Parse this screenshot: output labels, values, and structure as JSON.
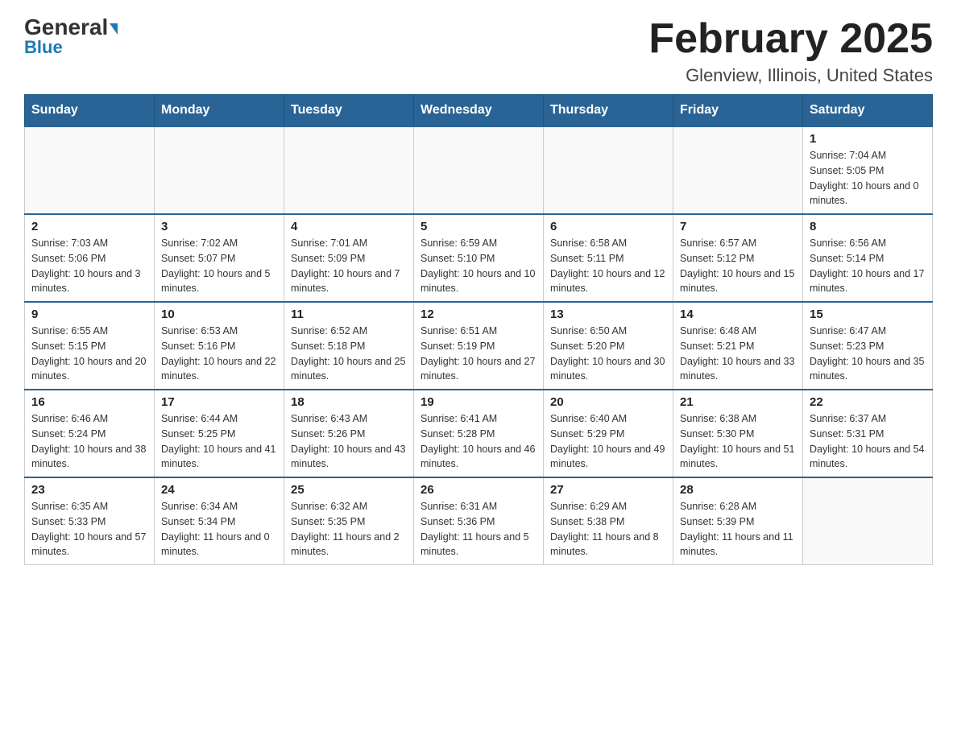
{
  "logo": {
    "general": "General",
    "blue": "Blue"
  },
  "title": {
    "month": "February 2025",
    "location": "Glenview, Illinois, United States"
  },
  "weekdays": [
    "Sunday",
    "Monday",
    "Tuesday",
    "Wednesday",
    "Thursday",
    "Friday",
    "Saturday"
  ],
  "weeks": [
    [
      {
        "day": "",
        "info": ""
      },
      {
        "day": "",
        "info": ""
      },
      {
        "day": "",
        "info": ""
      },
      {
        "day": "",
        "info": ""
      },
      {
        "day": "",
        "info": ""
      },
      {
        "day": "",
        "info": ""
      },
      {
        "day": "1",
        "info": "Sunrise: 7:04 AM\nSunset: 5:05 PM\nDaylight: 10 hours and 0 minutes."
      }
    ],
    [
      {
        "day": "2",
        "info": "Sunrise: 7:03 AM\nSunset: 5:06 PM\nDaylight: 10 hours and 3 minutes."
      },
      {
        "day": "3",
        "info": "Sunrise: 7:02 AM\nSunset: 5:07 PM\nDaylight: 10 hours and 5 minutes."
      },
      {
        "day": "4",
        "info": "Sunrise: 7:01 AM\nSunset: 5:09 PM\nDaylight: 10 hours and 7 minutes."
      },
      {
        "day": "5",
        "info": "Sunrise: 6:59 AM\nSunset: 5:10 PM\nDaylight: 10 hours and 10 minutes."
      },
      {
        "day": "6",
        "info": "Sunrise: 6:58 AM\nSunset: 5:11 PM\nDaylight: 10 hours and 12 minutes."
      },
      {
        "day": "7",
        "info": "Sunrise: 6:57 AM\nSunset: 5:12 PM\nDaylight: 10 hours and 15 minutes."
      },
      {
        "day": "8",
        "info": "Sunrise: 6:56 AM\nSunset: 5:14 PM\nDaylight: 10 hours and 17 minutes."
      }
    ],
    [
      {
        "day": "9",
        "info": "Sunrise: 6:55 AM\nSunset: 5:15 PM\nDaylight: 10 hours and 20 minutes."
      },
      {
        "day": "10",
        "info": "Sunrise: 6:53 AM\nSunset: 5:16 PM\nDaylight: 10 hours and 22 minutes."
      },
      {
        "day": "11",
        "info": "Sunrise: 6:52 AM\nSunset: 5:18 PM\nDaylight: 10 hours and 25 minutes."
      },
      {
        "day": "12",
        "info": "Sunrise: 6:51 AM\nSunset: 5:19 PM\nDaylight: 10 hours and 27 minutes."
      },
      {
        "day": "13",
        "info": "Sunrise: 6:50 AM\nSunset: 5:20 PM\nDaylight: 10 hours and 30 minutes."
      },
      {
        "day": "14",
        "info": "Sunrise: 6:48 AM\nSunset: 5:21 PM\nDaylight: 10 hours and 33 minutes."
      },
      {
        "day": "15",
        "info": "Sunrise: 6:47 AM\nSunset: 5:23 PM\nDaylight: 10 hours and 35 minutes."
      }
    ],
    [
      {
        "day": "16",
        "info": "Sunrise: 6:46 AM\nSunset: 5:24 PM\nDaylight: 10 hours and 38 minutes."
      },
      {
        "day": "17",
        "info": "Sunrise: 6:44 AM\nSunset: 5:25 PM\nDaylight: 10 hours and 41 minutes."
      },
      {
        "day": "18",
        "info": "Sunrise: 6:43 AM\nSunset: 5:26 PM\nDaylight: 10 hours and 43 minutes."
      },
      {
        "day": "19",
        "info": "Sunrise: 6:41 AM\nSunset: 5:28 PM\nDaylight: 10 hours and 46 minutes."
      },
      {
        "day": "20",
        "info": "Sunrise: 6:40 AM\nSunset: 5:29 PM\nDaylight: 10 hours and 49 minutes."
      },
      {
        "day": "21",
        "info": "Sunrise: 6:38 AM\nSunset: 5:30 PM\nDaylight: 10 hours and 51 minutes."
      },
      {
        "day": "22",
        "info": "Sunrise: 6:37 AM\nSunset: 5:31 PM\nDaylight: 10 hours and 54 minutes."
      }
    ],
    [
      {
        "day": "23",
        "info": "Sunrise: 6:35 AM\nSunset: 5:33 PM\nDaylight: 10 hours and 57 minutes."
      },
      {
        "day": "24",
        "info": "Sunrise: 6:34 AM\nSunset: 5:34 PM\nDaylight: 11 hours and 0 minutes."
      },
      {
        "day": "25",
        "info": "Sunrise: 6:32 AM\nSunset: 5:35 PM\nDaylight: 11 hours and 2 minutes."
      },
      {
        "day": "26",
        "info": "Sunrise: 6:31 AM\nSunset: 5:36 PM\nDaylight: 11 hours and 5 minutes."
      },
      {
        "day": "27",
        "info": "Sunrise: 6:29 AM\nSunset: 5:38 PM\nDaylight: 11 hours and 8 minutes."
      },
      {
        "day": "28",
        "info": "Sunrise: 6:28 AM\nSunset: 5:39 PM\nDaylight: 11 hours and 11 minutes."
      },
      {
        "day": "",
        "info": ""
      }
    ]
  ]
}
